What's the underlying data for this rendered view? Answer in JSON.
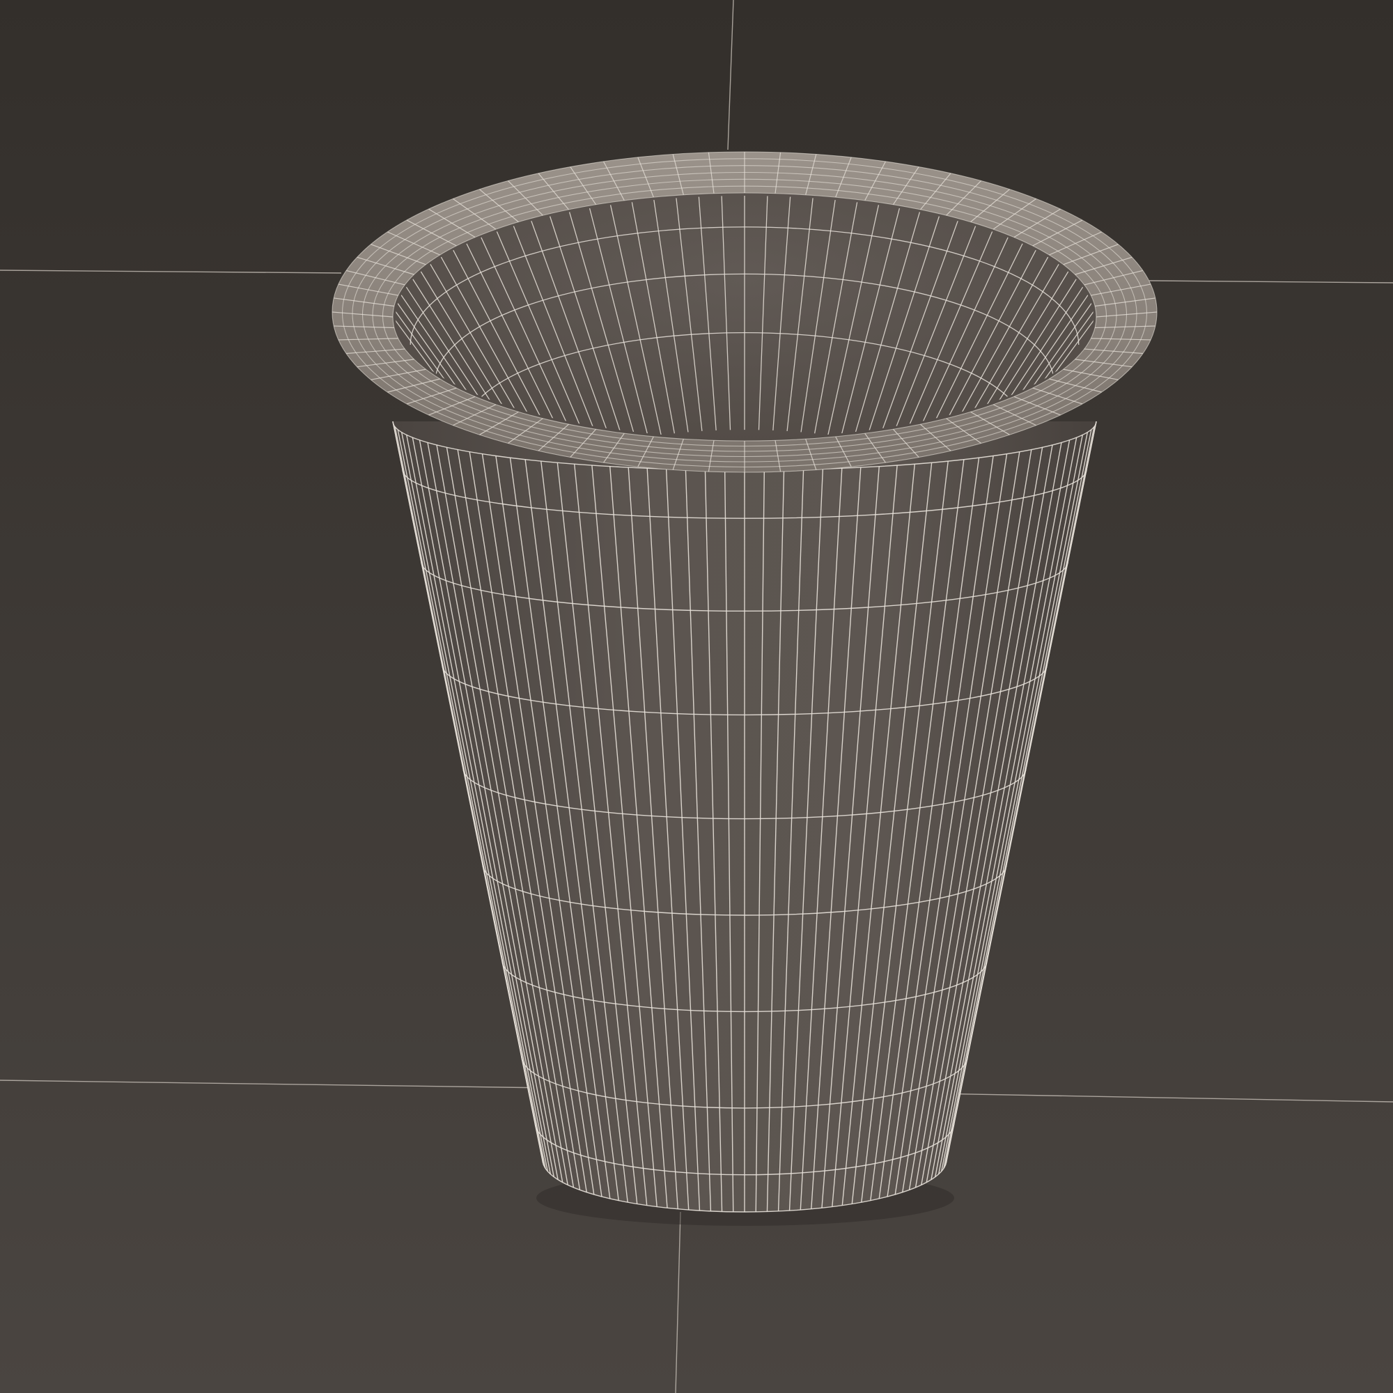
{
  "scene": {
    "subject": "wireframe-cup",
    "colors": {
      "background_top": "#332f2b",
      "background_bottom": "#4a4541",
      "floor_line": "#bdb6ae",
      "cup_body": "#5b544f",
      "cup_body_shadow": "#4a4440",
      "cup_inner": "#5a534e",
      "rim": "#8a827b",
      "wire": "#e8e2da"
    }
  }
}
